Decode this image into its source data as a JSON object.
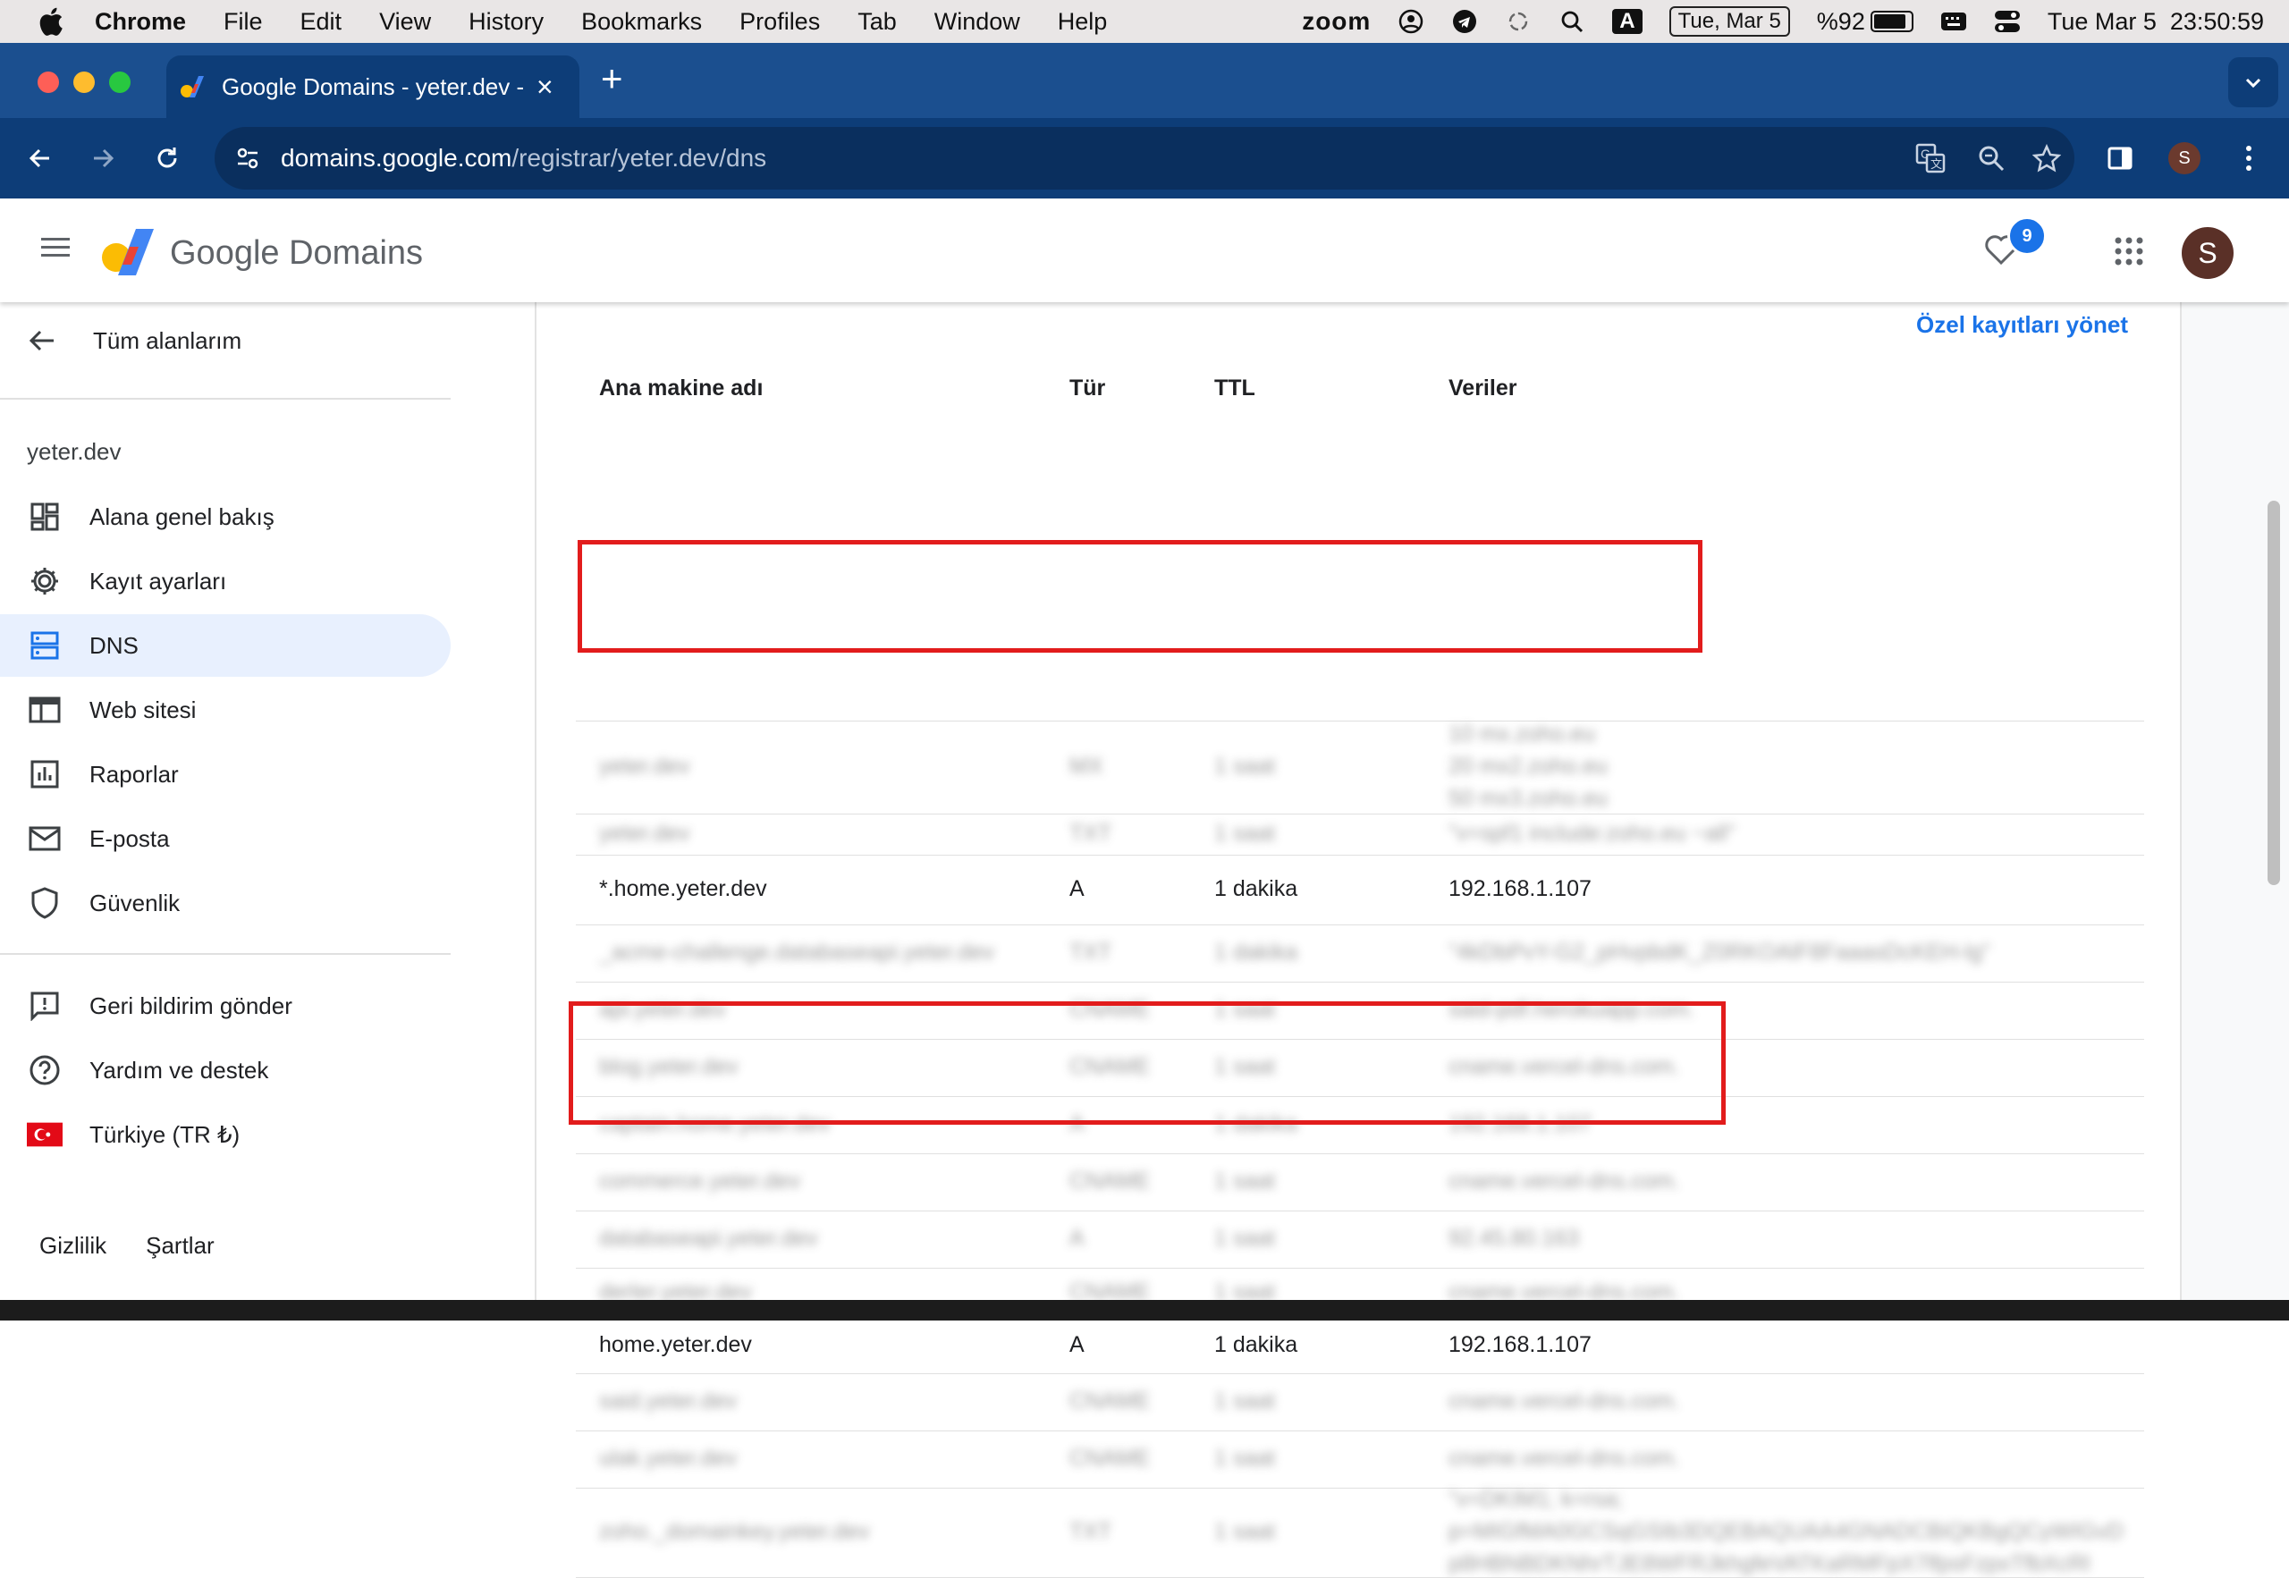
{
  "menubar": {
    "app_name": "Chrome",
    "items": [
      "File",
      "Edit",
      "View",
      "History",
      "Bookmarks",
      "Profiles",
      "Tab",
      "Window",
      "Help"
    ],
    "zoom_label": "zoom",
    "input_letter": "A",
    "date_chip": "Tue, Mar 5",
    "battery_text": "%92",
    "battery_level": 0.92,
    "clock": "Tue Mar 5  23:50:59"
  },
  "browser": {
    "tab_title": "Google Domains - yeter.dev - ",
    "url_host": "domains.google.com",
    "url_path": "/registrar/yeter.dev/dns",
    "profile_initial": "S"
  },
  "header": {
    "brand_google": "Google",
    "brand_product": "Domains",
    "favorites_count": "9",
    "avatar_initial": "S"
  },
  "sidebar": {
    "back_label": "Tüm alanlarım",
    "domain": "yeter.dev",
    "nav": [
      {
        "label": "Alana genel bakış",
        "icon": "dashboard-icon"
      },
      {
        "label": "Kayıt ayarları",
        "icon": "gear-icon"
      },
      {
        "label": "DNS",
        "icon": "dns-icon",
        "active": true
      },
      {
        "label": "Web sitesi",
        "icon": "web-icon"
      },
      {
        "label": "Raporlar",
        "icon": "bar-chart-icon"
      },
      {
        "label": "E-posta",
        "icon": "mail-icon"
      },
      {
        "label": "Güvenlik",
        "icon": "shield-icon"
      }
    ],
    "support": [
      {
        "label": "Geri bildirim gönder",
        "icon": "feedback-icon"
      },
      {
        "label": "Yardım ve destek",
        "icon": "help-icon"
      },
      {
        "label": "Türkiye (TR ₺)",
        "icon": "turkey-flag-icon"
      }
    ],
    "footer": {
      "privacy": "Gizlilik",
      "terms": "Şartlar"
    }
  },
  "dns": {
    "manage_link": "Özel kayıtları yönet",
    "columns": {
      "host": "Ana makine adı",
      "type": "Tür",
      "ttl": "TTL",
      "data": "Veriler"
    },
    "rows": [
      {
        "host": "yeter.dev",
        "type": "MX",
        "ttl": "1 saat",
        "data": [
          "10 mx.zoho.eu",
          "20 mx2.zoho.eu",
          "50 mx3.zoho.eu"
        ],
        "blurred": true
      },
      {
        "host": "yeter.dev",
        "type": "TXT",
        "ttl": "1 saat",
        "data": [
          "\"v=spf1 include:zoho.eu ~all\""
        ],
        "blurred": true
      },
      {
        "host": "*.home.yeter.dev",
        "type": "A",
        "ttl": "1 dakika",
        "data": [
          "192.168.1.107"
        ],
        "blurred": false,
        "highlighted": true
      },
      {
        "host": "_acme-challenge.databaseapi.yeter.dev",
        "type": "TXT",
        "ttl": "1 dakika",
        "data": [
          "\"4kDbPvY-G2_pHvpbdK_Z0RKOAlF8FaaasDcKEH-lg\""
        ],
        "blurred": true
      },
      {
        "host": "api.yeter.dev",
        "type": "CNAME",
        "ttl": "1 saat",
        "data": [
          "said-pdf.herokuapp.com."
        ],
        "blurred": true
      },
      {
        "host": "blog.yeter.dev",
        "type": "CNAME",
        "ttl": "1 saat",
        "data": [
          "cname.vercel-dns.com."
        ],
        "blurred": true
      },
      {
        "host": "captain.home.yeter.dev",
        "type": "A",
        "ttl": "1 dakika",
        "data": [
          "192.168.1.107"
        ],
        "blurred": true
      },
      {
        "host": "commerce.yeter.dev",
        "type": "CNAME",
        "ttl": "1 saat",
        "data": [
          "cname.vercel-dns.com."
        ],
        "blurred": true
      },
      {
        "host": "databaseapi.yeter.dev",
        "type": "A",
        "ttl": "1 saat",
        "data": [
          "92.45.80.163"
        ],
        "blurred": true
      },
      {
        "host": "derler.yeter.dev",
        "type": "CNAME",
        "ttl": "1 saat",
        "data": [
          "cname.vercel-dns.com."
        ],
        "blurred": true
      },
      {
        "host": "home.yeter.dev",
        "type": "A",
        "ttl": "1 dakika",
        "data": [
          "192.168.1.107"
        ],
        "blurred": false,
        "highlighted": true
      },
      {
        "host": "said.yeter.dev",
        "type": "CNAME",
        "ttl": "1 saat",
        "data": [
          "cname.vercel-dns.com."
        ],
        "blurred": true
      },
      {
        "host": "ulak.yeter.dev",
        "type": "CNAME",
        "ttl": "1 saat",
        "data": [
          "cname.vercel-dns.com."
        ],
        "blurred": true
      },
      {
        "host": "zoho._domainkey.yeter.dev",
        "type": "TXT",
        "ttl": "1 saat",
        "data": [
          "\"v=DKIM1; k=rsa;",
          "p=MIGfMA0GCSqGSIb3DQEBAQUAA4GNADCBiQKBgQCyWIGvD",
          "p8HBNBDKNhrTJE8WFRJkhgfeVATKaRMFpX7lfpsFzpxTfbXcRl"
        ],
        "blurred": true
      }
    ]
  },
  "colors": {
    "accent": "#1a73e8",
    "tabstrip": "#1b4f8f",
    "toolbar": "#0d3d78",
    "highlight": "#e21c1c",
    "nav_active_bg": "#e8f0fe"
  }
}
